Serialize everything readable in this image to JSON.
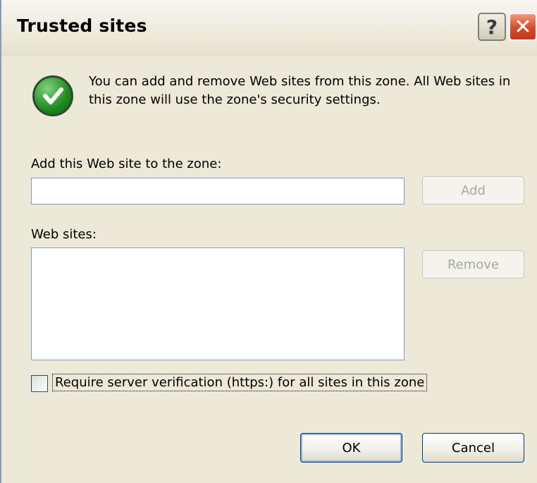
{
  "dialog": {
    "title": "Trusted sites",
    "help_button": "?",
    "close_button": "X"
  },
  "info": {
    "icon": "check-icon",
    "text": "You can add and remove Web sites from this zone. All Web sites in this zone will use the zone's security settings."
  },
  "add_site": {
    "label": "Add this Web site to the zone:",
    "value": "",
    "button": "Add"
  },
  "web_sites": {
    "label": "Web sites:",
    "items": [],
    "remove_button": "Remove"
  },
  "https_check": {
    "checked": false,
    "label": "Require server verification (https:) for all sites in this zone"
  },
  "footer": {
    "ok": "OK",
    "cancel": "Cancel"
  },
  "colors": {
    "face": "#ece9d8",
    "field_border": "#7f9db9",
    "button_border": "#003c74",
    "disabled_text": "#aca899"
  }
}
